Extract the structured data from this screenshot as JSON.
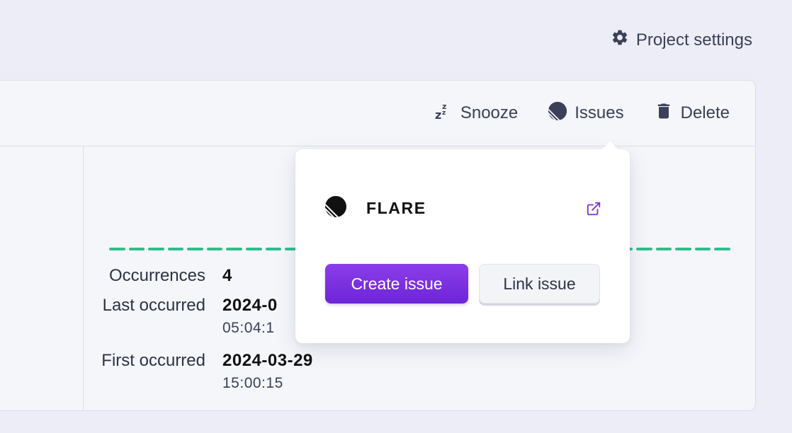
{
  "header": {
    "project_settings": "Project settings"
  },
  "toolbar": {
    "snooze": "Snooze",
    "issues": "Issues",
    "delete": "Delete"
  },
  "stats": {
    "occurrences_label": "Occurrences",
    "occurrences_value": "4",
    "last_label": "Last occurred",
    "last_date": "2024-0",
    "last_time": "05:04:1",
    "first_label": "First occurred",
    "first_date": "2024-03-29",
    "first_time": "15:00:15"
  },
  "popover": {
    "title": "FLARE",
    "create_label": "Create issue",
    "link_label": "Link issue"
  },
  "colors": {
    "accent": "#7b2fe0",
    "bars": "#2fbf8a",
    "background": "#ededf7"
  },
  "icons": {
    "settings": "gear-icon",
    "snooze": "zzz-icon",
    "issues": "linear-logo-icon",
    "delete": "trash-icon",
    "external": "external-link-icon"
  }
}
